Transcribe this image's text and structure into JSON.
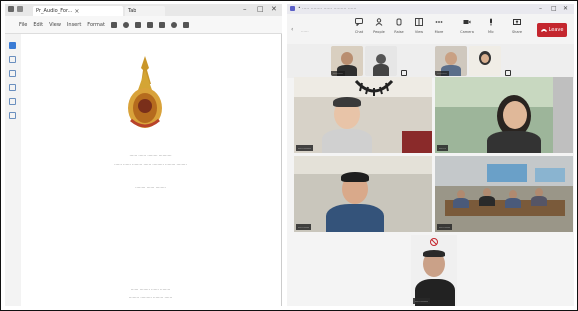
{
  "left_window": {
    "tab1": "Pr_Audio_For...",
    "tab2": "Tab",
    "win_min": "–",
    "win_max": "□",
    "win_close": "✕",
    "menu": [
      "File",
      "Edit",
      "View",
      "Insert",
      "Format"
    ],
    "document": {
      "line1": "...... ...... ........ ..........",
      "line2": "...... ...... ........ ...... ......... ........ ........",
      "line3": "........ ...... ........",
      "line4": "...... ........ ...... ........",
      "line5": "........ ......... ........ ......"
    }
  },
  "meeting": {
    "title": "• ..... ........ ...... ......... ......",
    "ctrl_min": "–",
    "ctrl_max": "□",
    "ctrl_close": "✕",
    "back_icon": "‹",
    "back_label": "......",
    "toolbar": [
      {
        "label": "Chat",
        "icon": "chat-icon"
      },
      {
        "label": "People",
        "icon": "people-icon"
      },
      {
        "label": "Raise",
        "icon": "hand-icon"
      },
      {
        "label": "View",
        "icon": "view-icon"
      },
      {
        "label": "More",
        "icon": "more-icon"
      },
      {
        "label": "Camera",
        "icon": "camera-icon"
      },
      {
        "label": "Mic",
        "icon": "mic-icon"
      },
      {
        "label": "Share",
        "icon": "share-icon"
      }
    ],
    "leave_label": "Leave",
    "thumbnails": [
      {
        "name": "..........",
        "color": "#d9cfc0"
      },
      {
        "name": "",
        "color": "#e6e6e6"
      },
      {
        "name": "..........",
        "color": "#cfc8be"
      },
      {
        "name": "",
        "color": "#f0ede6"
      }
    ],
    "tiles": [
      {
        "name": "............",
        "bg": "#d7d2c8",
        "skin": "#e8c4a8",
        "shirt": "#d0d0d0"
      },
      {
        "name": "......",
        "bg": "#9db59a",
        "skin": "#e0b899",
        "shirt": "#333333"
      },
      {
        "name": "..........",
        "bg": "#c9c6bc",
        "skin": "#d9a98a",
        "shirt": "#34537a"
      },
      {
        "name": "..........",
        "bg": "#9a9688",
        "skin": "#b08a70",
        "shirt": "#4a5a7a"
      },
      {
        "name": "............",
        "bg": "#f0f0f0",
        "skin": "#caa188",
        "shirt": "#222222"
      }
    ]
  }
}
